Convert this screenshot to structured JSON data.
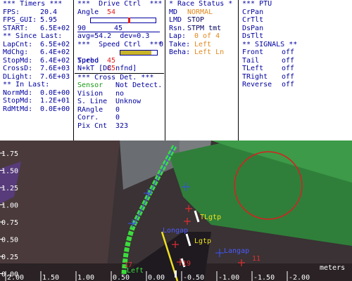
{
  "timers": {
    "header": "*** Timers ***",
    "rows": [
      {
        "label": "FPS:",
        "value": "20.4"
      },
      {
        "label": "FPS_GUI:",
        "value": "5.95"
      },
      {
        "label": "START:",
        "value": "6.5E+02"
      }
    ],
    "since_header": "** Since Last:",
    "since_rows": [
      {
        "label": "LapCnt:",
        "value": "6.5E+02"
      },
      {
        "label": "MdChg:",
        "value": "6.4E+02"
      },
      {
        "label": "StopMd:",
        "value": "6.4E+02"
      },
      {
        "label": "CrossD:",
        "value": "7.6E+03"
      },
      {
        "label": "DLight:",
        "value": "7.6E+03"
      }
    ],
    "in_header": "** In Last:",
    "in_rows": [
      {
        "label": "NormMd:",
        "value": "0.0E+00"
      },
      {
        "label": "StopMd:",
        "value": "1.2E+01"
      },
      {
        "label": "RdMtMd:",
        "value": "0.0E+00"
      }
    ]
  },
  "drive": {
    "header": "***  Drive Ctrl  ***",
    "angle_label": "Angle",
    "angle_value": "54",
    "scale_left": "90",
    "scale_right": "0",
    "scale_mid": "45",
    "angle_fraction": 0.6,
    "avg_line": "avg=54.2  dev=0.3",
    "speed_header": "***  Speed Ctrl  ***",
    "speed_label": "Speed",
    "speed_value": "85",
    "speed_fraction": 0.85,
    "turbo_label": "Turbo",
    "turbo_value": "45",
    "nkt_line": "N+kT [DC nfnd]"
  },
  "cross": {
    "header": "*** Cross Det. ***",
    "rows": [
      {
        "label": "Sensor",
        "value": "Not Detect."
      },
      {
        "label": "Vision",
        "value": "no"
      },
      {
        "label": "S. Line",
        "value": "Unknow"
      },
      {
        "label": "RAngle",
        "value": "0"
      },
      {
        "label": "Corr.",
        "value": "0"
      },
      {
        "label": "Pix Cnt",
        "value": "323"
      }
    ]
  },
  "race": {
    "header": "* Race Status *",
    "rows": [
      {
        "label": "MD",
        "value": "NORMAL"
      },
      {
        "label": "LMD",
        "value": "STOP"
      },
      {
        "label": "Rsn.",
        "value": "STPM tmt"
      },
      {
        "label": "Lap:",
        "value": "0 of 4"
      },
      {
        "label": "Take:",
        "value": "Left"
      },
      {
        "label": "Beha:",
        "value": "Left Ln"
      }
    ]
  },
  "ptu": {
    "header": "*** PTU",
    "items": [
      "CrPan",
      "CrTlt",
      "DsPan",
      "DsTlt"
    ]
  },
  "signals": {
    "header": "** SIGNALS **",
    "rows": [
      {
        "label": "Front",
        "value": "off"
      },
      {
        "label": "Tail",
        "value": "off"
      },
      {
        "label": "TLeft",
        "value": "off"
      },
      {
        "label": "TRight",
        "value": "off"
      },
      {
        "label": "Reverse",
        "value": "off"
      }
    ]
  },
  "camera": {
    "y_ticks": [
      "1.75",
      "1.50",
      "1.25",
      "1.00",
      "0.75",
      "0.50",
      "0.25",
      "0.00"
    ],
    "x_ticks": [
      "2.00",
      "1.50",
      "1.00",
      "0.50",
      "0.00",
      "-0.50",
      "-1.00",
      "-1.50",
      "-2.00"
    ],
    "x_unit": "meters",
    "annotations": [
      "TLgtp",
      "Lgtp",
      "Longap",
      "Langap",
      "Left",
      "17",
      "19",
      "11"
    ]
  }
}
